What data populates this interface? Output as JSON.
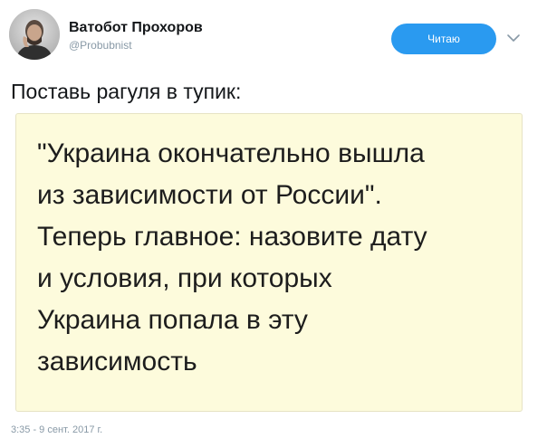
{
  "author": {
    "display_name": "Ватобот Прохоров",
    "handle": "@Probubnist",
    "avatar_icon": "person-avatar-icon"
  },
  "follow_button": {
    "label": "Читаю",
    "color": "#2a9af0"
  },
  "menu": {
    "icon": "chevron-down-icon"
  },
  "tweet": {
    "text": "Поставь рагуля в тупик:",
    "quote_lines": [
      "\"Украина окончательно вышла",
      "из зависимости от России\".",
      "Теперь главное: назовите дату",
      "и условия, при которых",
      "Украина попала в эту",
      "зависимость"
    ],
    "quote_background": "#fdfbdc",
    "timestamp": "3:35 - 9 сент. 2017 г."
  }
}
